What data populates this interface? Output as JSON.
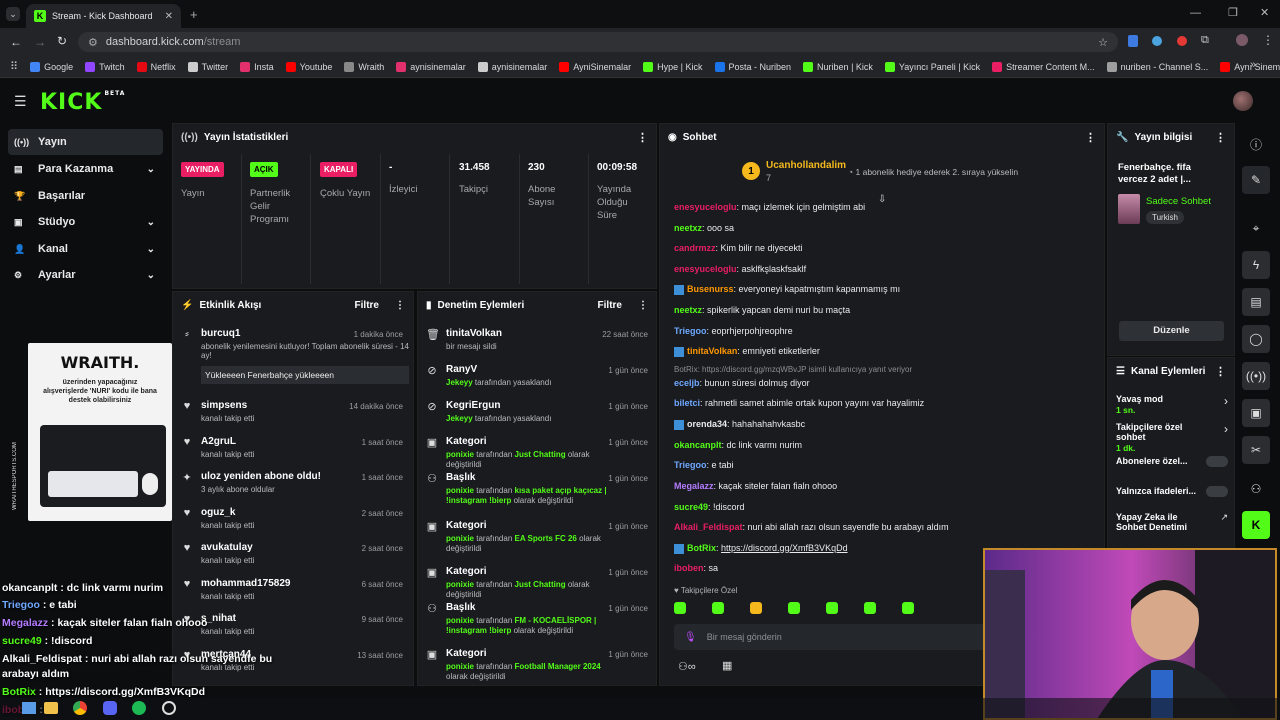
{
  "browser": {
    "tab_title": "Stream - Kick Dashboard",
    "url_host": "dashboard.kick.com",
    "url_path": "/stream",
    "bookmarks": [
      {
        "label": "Google",
        "color": "#4285f4"
      },
      {
        "label": "Twitch",
        "color": "#9146ff"
      },
      {
        "label": "Netflix",
        "color": "#e50914"
      },
      {
        "label": "Twitter",
        "color": "#cccccc"
      },
      {
        "label": "Insta",
        "color": "#e1306c"
      },
      {
        "label": "Youtube",
        "color": "#ff0000"
      },
      {
        "label": "Wraith",
        "color": "#888888"
      },
      {
        "label": "aynisinemalar",
        "color": "#e1306c"
      },
      {
        "label": "aynisinemalar",
        "color": "#cccccc"
      },
      {
        "label": "AyniSinemalar",
        "color": "#ff0000"
      },
      {
        "label": "Hype | Kick",
        "color": "#53fc18"
      },
      {
        "label": "Posta - Nuriben",
        "color": "#1a73e8"
      },
      {
        "label": "Nuriben | Kick",
        "color": "#53fc18"
      },
      {
        "label": "Yayıncı Paneli | Kick",
        "color": "#53fc18"
      },
      {
        "label": "Streamer Content M...",
        "color": "#e91e63"
      },
      {
        "label": "nuriben - Channel S...",
        "color": "#9e9e9e"
      },
      {
        "label": "Aynı Sinemalar - Ça...",
        "color": "#ff0000"
      }
    ]
  },
  "header": {
    "logo": "KICK",
    "logo_sup": "BETA"
  },
  "nav": [
    {
      "label": "Yayın",
      "icon": "broadcast-icon",
      "active": true,
      "chevron": false
    },
    {
      "label": "Para Kazanma",
      "icon": "money-icon",
      "active": false,
      "chevron": true
    },
    {
      "label": "Başarılar",
      "icon": "trophy-icon",
      "active": false,
      "chevron": false
    },
    {
      "label": "Stüdyo",
      "icon": "studio-icon",
      "active": false,
      "chevron": true
    },
    {
      "label": "Kanal",
      "icon": "user-icon",
      "active": false,
      "chevron": true
    },
    {
      "label": "Ayarlar",
      "icon": "gear-icon",
      "active": false,
      "chevron": true
    }
  ],
  "stats": {
    "title": "Yayın İstatistikleri",
    "items": [
      {
        "badge": "YAYINDA",
        "badge_color": "#e91e63",
        "label": "Yayın"
      },
      {
        "badge": "AÇIK",
        "badge_color": "#53fc18",
        "label": "Partnerlik Gelir Programı"
      },
      {
        "badge": "KAPALI",
        "badge_color": "#e91e63",
        "label": "Çoklu Yayın"
      },
      {
        "value": "-",
        "label": "İzleyici"
      },
      {
        "value": "31.458",
        "label": "Takipçi"
      },
      {
        "value": "230",
        "label": "Abone Sayısı"
      },
      {
        "value": "00:09:58",
        "label": "Yayında Olduğu Süre"
      }
    ]
  },
  "activity": {
    "title": "Etkinlik Akışı",
    "filter": "Filtre",
    "items": [
      {
        "icon": "gift-icon",
        "name": "burcuq1",
        "sub": "abonelik yenilemesini kutluyor! Toplam abonelik süresi - 14 ay!",
        "time": "1 dakika önce",
        "message": "Yükleeeen Fenerbahçe yükleeeen"
      },
      {
        "icon": "heart-icon",
        "name": "simpsens",
        "sub": "kanalı takip etti",
        "time": "14 dakika önce"
      },
      {
        "icon": "heart-icon",
        "name": "A2gruL",
        "sub": "kanalı takip etti",
        "time": "1 saat önce"
      },
      {
        "icon": "star-icon",
        "name": "uloz yeniden abone oldu!",
        "sub": "3 aylık abone oldular",
        "time": "1 saat önce"
      },
      {
        "icon": "heart-icon",
        "name": "oguz_k",
        "sub": "kanalı takip etti",
        "time": "2 saat önce"
      },
      {
        "icon": "heart-icon",
        "name": "avukatulay",
        "sub": "kanalı takip etti",
        "time": "2 saat önce"
      },
      {
        "icon": "heart-icon",
        "name": "mohammad175829",
        "sub": "kanalı takip etti",
        "time": "6 saat önce"
      },
      {
        "icon": "heart-icon",
        "name": "s_nihat",
        "sub": "kanalı takip etti",
        "time": "9 saat önce"
      },
      {
        "icon": "heart-icon",
        "name": "mertcan44",
        "sub": "kanalı takip etti",
        "time": "13 saat önce"
      }
    ]
  },
  "moderation": {
    "title": "Denetim Eylemleri",
    "filter": "Filtre",
    "items": [
      {
        "icon": "trash-icon",
        "title": "tinitaVolkan",
        "l1": "bir mesajı sildi",
        "l2": "",
        "time": "22 saat önce"
      },
      {
        "icon": "ban-icon",
        "title": "RanyV",
        "l1": "Jekeyy",
        "l1b": " tarafından yasaklandı",
        "l2": "",
        "time": "1 gün önce"
      },
      {
        "icon": "ban-icon",
        "title": "KegriErgun",
        "l1": "Jekeyy",
        "l1b": " tarafından yasaklandı",
        "l2": "",
        "time": "1 gün önce"
      },
      {
        "icon": "category-icon",
        "title": "Kategori",
        "l1": "ponixie",
        "l1b": " tarafından ",
        "l1c": "Just Chatting",
        "l1d": " olarak değiştirildi",
        "l2": "",
        "time": "1 gün önce"
      },
      {
        "icon": "title-icon",
        "title": "Başlık",
        "l1": "ponixie",
        "l1b": " tarafından ",
        "l1c": "kısa paket açıp kaçıcaz | !instagram !bierp",
        "l1d": " olarak değiştirildi",
        "l2": "",
        "time": "1 gün önce"
      },
      {
        "icon": "category-icon",
        "title": "Kategori",
        "l1": "ponixie",
        "l1b": " tarafından ",
        "l1c": "EA Sports FC 26",
        "l1d": " olarak değiştirildi",
        "l2": "",
        "time": "1 gün önce"
      },
      {
        "icon": "category-icon",
        "title": "Kategori",
        "l1": "ponixie",
        "l1b": " tarafından ",
        "l1c": "Just Chatting",
        "l1d": " olarak değiştirildi",
        "l2": "",
        "time": "1 gün önce"
      },
      {
        "icon": "title-icon",
        "title": "Başlık",
        "l1": "ponixie",
        "l1b": " tarafından ",
        "l1c": "FM - KOCAELİSPOR | !instagram !bierp",
        "l1d": " olarak değiştirildi",
        "l2": "",
        "time": "1 gün önce"
      },
      {
        "icon": "category-icon",
        "title": "Kategori",
        "l1": "ponixie",
        "l1b": " tarafından ",
        "l1c": "Football Manager 2024",
        "l1d": " olarak değiştirildi",
        "l2": "",
        "time": "1 gün önce"
      }
    ]
  },
  "chat": {
    "title": "Sohbet",
    "pinned_user": "Ucanhollandalim",
    "pinned_count": "7",
    "pinned_note": "1 abonelik hediye ederek 2. sıraya yükselin",
    "messages": [
      {
        "user": "enesyuceloglu",
        "color": "#e91e63",
        "text": "maçı izlemek için gelmiştim abi"
      },
      {
        "user": "neetxz",
        "color": "#53fc18",
        "text": "ooo sa"
      },
      {
        "user": "candrmzz",
        "color": "#e91e63",
        "text": "Kim bilir ne diyecekti"
      },
      {
        "user": "enesyuceloglu",
        "color": "#e91e63",
        "text": "asklfkşlaskfsaklf"
      },
      {
        "user": "Busenurss",
        "color": "#ff9800",
        "text": "everyoneyi kapatmıştım kapanmamış mı"
      },
      {
        "user": "neetxz",
        "color": "#53fc18",
        "text": "spikerlik yapcan demi nuri bu maçta"
      },
      {
        "user": "Triegoo",
        "color": "#6fa8ff",
        "text": "eoprhjerpohjreophre"
      },
      {
        "user": "tinitaVolkan",
        "color": "#ff9800",
        "text": "emniyeti etiketlerler"
      },
      {
        "user": "eceljb",
        "color": "#6fa8ff",
        "text": "bunun süresi dolmuş diyor"
      },
      {
        "user": "biletci",
        "color": "#6fa8ff",
        "text": "rahmetli samet abimle ortak kupon yayını var hayalimiz"
      },
      {
        "user": "orenda34",
        "color": "#e8eaec",
        "text": "hahahahahvkasbc"
      },
      {
        "user": "okancanplt",
        "color": "#53fc18",
        "text": "dc link varmı nurim"
      },
      {
        "user": "Triegoo",
        "color": "#6fa8ff",
        "text": "e tabi"
      },
      {
        "user": "Megalazz",
        "color": "#b57cff",
        "text": "kaçak siteler falan fialn ohooo"
      },
      {
        "user": "sucre49",
        "color": "#53fc18",
        "text": "!discord"
      },
      {
        "user": "Alkali_Feldispat",
        "color": "#e91e63",
        "text": "nuri abi allah razı olsun sayendfe bu arabayı aldım"
      },
      {
        "user": "BotRix",
        "color": "#53fc18",
        "text": "https://discord.gg/XmfB3VKqDd"
      },
      {
        "user": "iboben",
        "color": "#e91e63",
        "text": "sa"
      }
    ],
    "reply_note": "BotRix: https://discord.gg/mzqWBvJP isimli kullanıcıya yanıt veriyor",
    "followers_label": "Takipçilere Özel",
    "input_placeholder": "Bir mesaj gönderin"
  },
  "stream_info": {
    "title": "Yayın bilgisi",
    "stream_title": "Fenerbahçe. fifa vercez 2 adet |...",
    "category": "Sadece Sohbet",
    "tag": "Turkish",
    "edit_button": "Düzenle"
  },
  "channel_actions": {
    "title": "Kanal Eylemleri",
    "items": [
      {
        "label": "Yavaş mod",
        "value": "1 sn.",
        "type": "chevron"
      },
      {
        "label": "Takipçilere özel sohbet",
        "value": "1 dk.",
        "type": "chevron"
      },
      {
        "label": "Abonelere özel...",
        "type": "toggle"
      },
      {
        "label": "Yalnızca ifadeleri...",
        "type": "toggle"
      },
      {
        "label": "Yapay Zeka ile Sohbet Denetimi",
        "type": "external"
      }
    ]
  },
  "ad": {
    "brand": "WRAITH.",
    "text": "üzerinden yapacağınız alışverişlerde 'NURI' kodu ile bana destek olabilirsiniz",
    "side": "WRAITHESPORTS.COM"
  },
  "overlay_chat": [
    {
      "user": "okancanplt",
      "color": "#ffffff",
      "text": "dc link varmı nurim"
    },
    {
      "user": "Triegoo",
      "color": "#6fa8ff",
      "text": "e tabi"
    },
    {
      "user": "Megalazz",
      "color": "#b57cff",
      "text": "kaçak siteler falan fialn ohooo"
    },
    {
      "user": "sucre49",
      "color": "#53fc18",
      "text": "!discord"
    },
    {
      "user": "Alkali_Feldispat",
      "color": "#ffffff",
      "text": "nuri abi allah razı olsun sayendfe bu"
    },
    {
      "user": "",
      "color": "#ffffff",
      "text": "arabayı aldım"
    },
    {
      "user": "BotRix",
      "color": "#53fc18",
      "text": "https://discord.gg/XmfB3VKqDd"
    },
    {
      "user": "iboben",
      "color": "#e91e63",
      "text": "sa"
    }
  ]
}
